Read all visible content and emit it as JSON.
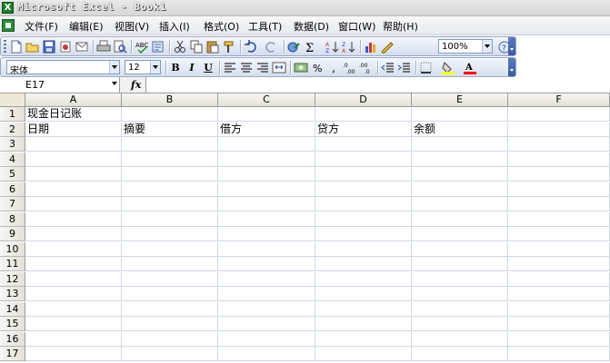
{
  "window": {
    "title": "Microsoft Excel - Book1"
  },
  "menu": {
    "items": [
      "文件(F)",
      "编辑(E)",
      "视图(V)",
      "插入(I)",
      "格式(O)",
      "工具(T)",
      "数据(D)",
      "窗口(W)",
      "帮助(H)"
    ]
  },
  "toolbar": {
    "zoom": "100%",
    "font_name": "宋体",
    "font_size": "12",
    "bold_label": "B",
    "italic_label": "I",
    "underline_label": "U",
    "icons": [
      "new-icon",
      "open-icon",
      "save-icon",
      "permission-icon",
      "email-icon",
      "print-icon",
      "print-preview-icon",
      "spelling-icon",
      "research-icon",
      "cut-icon",
      "copy-icon",
      "paste-icon",
      "format-painter-icon",
      "undo-icon",
      "redo-icon",
      "hyperlink-icon",
      "autosum-icon",
      "sort-ascending-icon",
      "sort-descending-icon",
      "chart-wizard-icon",
      "drawing-icon",
      "help-icon"
    ]
  },
  "formula_bar": {
    "name_box": "E17",
    "fx_label": "fx",
    "content": ""
  },
  "sheet": {
    "columns": [
      "A",
      "B",
      "C",
      "D",
      "E",
      "F"
    ],
    "rows": [
      "1",
      "2",
      "3",
      "4",
      "5",
      "6",
      "7",
      "8",
      "9",
      "10",
      "11",
      "12",
      "13",
      "14",
      "15",
      "16",
      "17"
    ],
    "cells": {
      "A1": "现金日记账",
      "A2": "日期",
      "B2": "摘要",
      "C2": "借方",
      "D2": "贷方",
      "E2": "余额"
    }
  },
  "colors": {
    "accent": "#3b5aa0",
    "toolbar_bg": "#d5ddee",
    "header_bg": "#ece9d8"
  }
}
